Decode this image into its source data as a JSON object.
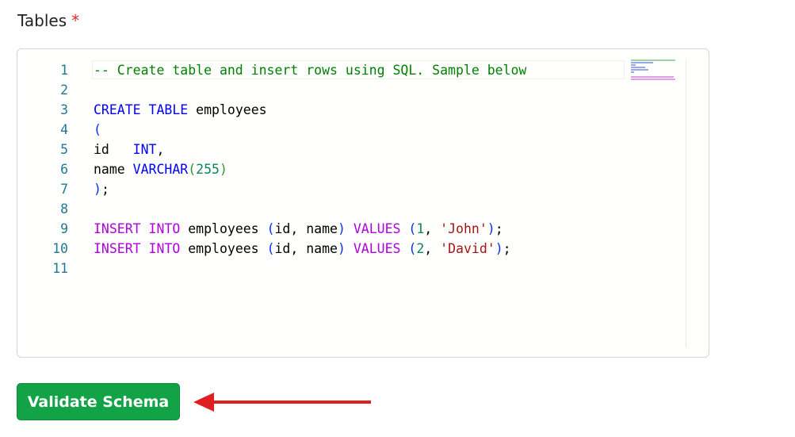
{
  "field": {
    "label": "Tables",
    "required_marker": "*"
  },
  "editor": {
    "lines": [
      {
        "num": "1",
        "tokens": [
          {
            "t": "-- Create table and insert rows using SQL. Sample below",
            "c": "tok-comment"
          }
        ]
      },
      {
        "num": "2",
        "tokens": []
      },
      {
        "num": "3",
        "tokens": [
          {
            "t": "CREATE TABLE",
            "c": "tok-kw"
          },
          {
            "t": " employees",
            "c": "tok-plain"
          }
        ]
      },
      {
        "num": "4",
        "tokens": [
          {
            "t": "(",
            "c": "tok-paren-blue"
          }
        ]
      },
      {
        "num": "5",
        "tokens": [
          {
            "t": "id   ",
            "c": "tok-plain"
          },
          {
            "t": "INT",
            "c": "tok-kw"
          },
          {
            "t": ",",
            "c": "tok-plain"
          }
        ]
      },
      {
        "num": "6",
        "tokens": [
          {
            "t": "name ",
            "c": "tok-plain"
          },
          {
            "t": "VARCHAR",
            "c": "tok-kw"
          },
          {
            "t": "(",
            "c": "tok-paren-green"
          },
          {
            "t": "255",
            "c": "tok-num"
          },
          {
            "t": ")",
            "c": "tok-paren-green"
          }
        ]
      },
      {
        "num": "7",
        "tokens": [
          {
            "t": ")",
            "c": "tok-paren-blue"
          },
          {
            "t": ";",
            "c": "tok-plain"
          }
        ]
      },
      {
        "num": "8",
        "tokens": []
      },
      {
        "num": "9",
        "tokens": [
          {
            "t": "INSERT INTO",
            "c": "tok-dml"
          },
          {
            "t": " employees ",
            "c": "tok-plain"
          },
          {
            "t": "(",
            "c": "tok-paren-blue"
          },
          {
            "t": "id, name",
            "c": "tok-plain"
          },
          {
            "t": ")",
            "c": "tok-paren-blue"
          },
          {
            "t": " ",
            "c": "tok-plain"
          },
          {
            "t": "VALUES",
            "c": "tok-dml"
          },
          {
            "t": " ",
            "c": "tok-plain"
          },
          {
            "t": "(",
            "c": "tok-paren-blue"
          },
          {
            "t": "1",
            "c": "tok-num"
          },
          {
            "t": ", ",
            "c": "tok-plain"
          },
          {
            "t": "'John'",
            "c": "tok-str"
          },
          {
            "t": ")",
            "c": "tok-paren-blue"
          },
          {
            "t": ";",
            "c": "tok-plain"
          }
        ]
      },
      {
        "num": "10",
        "tokens": [
          {
            "t": "INSERT INTO",
            "c": "tok-dml"
          },
          {
            "t": " employees ",
            "c": "tok-plain"
          },
          {
            "t": "(",
            "c": "tok-paren-blue"
          },
          {
            "t": "id, name",
            "c": "tok-plain"
          },
          {
            "t": ")",
            "c": "tok-paren-blue"
          },
          {
            "t": " ",
            "c": "tok-plain"
          },
          {
            "t": "VALUES",
            "c": "tok-dml"
          },
          {
            "t": " ",
            "c": "tok-plain"
          },
          {
            "t": "(",
            "c": "tok-paren-blue"
          },
          {
            "t": "2",
            "c": "tok-num"
          },
          {
            "t": ", ",
            "c": "tok-plain"
          },
          {
            "t": "'David'",
            "c": "tok-str"
          },
          {
            "t": ")",
            "c": "tok-paren-blue"
          },
          {
            "t": ";",
            "c": "tok-plain"
          }
        ]
      },
      {
        "num": "11",
        "tokens": []
      }
    ]
  },
  "actions": {
    "validate_label": "Validate Schema"
  },
  "colors": {
    "button": "#13a347",
    "arrow": "#e02020",
    "required": "#d32f2f"
  },
  "icons": {
    "pointer": "arrow-left-icon"
  }
}
